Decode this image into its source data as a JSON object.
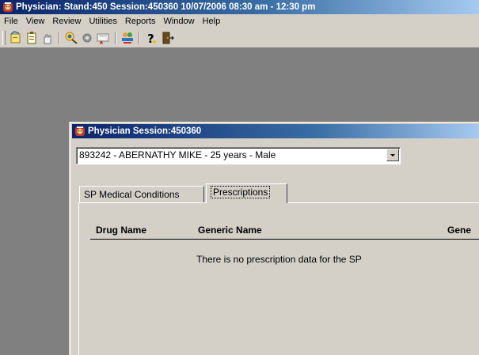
{
  "app_window": {
    "title": "Physician: Stand:450 Session:450360 10/07/2006 08:30 am - 12:30 pm"
  },
  "menu": [
    "File",
    "View",
    "Review",
    "Utilities",
    "Reports",
    "Window",
    "Help"
  ],
  "toolbar": {
    "buttons": [
      "new-session-icon",
      "clipboard-icon",
      "hand-icon",
      "search-people-icon",
      "record-icon",
      "certificate-icon",
      "people-transfer-icon",
      "help-icon",
      "exit-icon"
    ]
  },
  "session_window": {
    "title": "Physician Session:450360",
    "sp_selector": {
      "value": "893242 - ABERNATHY MIKE - 25  years  - Male"
    },
    "tabs": [
      {
        "label": "SP Medical Conditions",
        "active": false
      },
      {
        "label": "Prescriptions",
        "active": true
      }
    ],
    "table": {
      "columns": [
        "Drug Name",
        "Generic Name",
        "Gene"
      ],
      "empty_message": "There is no prescription data for the SP"
    }
  },
  "colors": {
    "titlebar_start": "#0a246a",
    "titlebar_end": "#a6caf0",
    "chrome": "#d4d0c8",
    "workspace": "#808080"
  }
}
